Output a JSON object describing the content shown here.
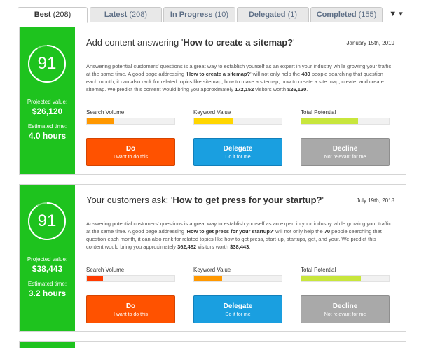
{
  "tabs": [
    {
      "label": "Best",
      "count": "(208)"
    },
    {
      "label": "Latest",
      "count": "(208)"
    },
    {
      "label": "In Progress",
      "count": "(10)"
    },
    {
      "label": "Delegated",
      "count": "(1)"
    },
    {
      "label": "Completed",
      "count": "(155)"
    }
  ],
  "filter_icon": "▼ ▾",
  "colors": {
    "sidebar": "#1ec31e",
    "do": "#ff5200",
    "delegate": "#1a9fe0",
    "decline": "#a9a9a9",
    "orange": "#ff9800",
    "red": "#ff3b00",
    "yellow": "#ffd600",
    "lime": "#c8e63c"
  },
  "labels": {
    "projected": "Projected value:",
    "estimated": "Estimated time:",
    "search_volume": "Search Volume",
    "keyword_value": "Keyword Value",
    "total_potential": "Total Potential",
    "do_title": "Do",
    "do_sub": "I want to do this",
    "delegate_title": "Delegate",
    "delegate_sub": "Do it for me",
    "decline_title": "Decline",
    "decline_sub": "Not relevant for me"
  },
  "cards": [
    {
      "score": "91",
      "score_fraction": 0.91,
      "projected_value": "$26,120",
      "estimated_time": "4.0 hours",
      "title_prefix": "Add content answering '",
      "title_bold": "How to create a sitemap?",
      "title_suffix": "'",
      "date": "January 15th, 2019",
      "desc_1": "Answering potential customers' questions is a great way to establish yourself as an expert in your industry while growing your traffic at the same time. A good page addressing '",
      "desc_b1": "How to create a sitemap?",
      "desc_2": "' will not only help the ",
      "desc_b2": "480",
      "desc_3": " people searching that question each month, it can also rank for related topics like sitemap, how to make a sitemap, how to create a site map, create, and create sitemap. We predict this content would bring you approximately ",
      "desc_b3": "172,152",
      "desc_4": " visitors worth ",
      "desc_b4": "$26,120",
      "desc_5": ".",
      "search_volume": 0.3,
      "keyword_value": 0.45,
      "total_potential": 0.65
    },
    {
      "score": "91",
      "score_fraction": 0.91,
      "projected_value": "$38,443",
      "estimated_time": "3.2 hours",
      "title_prefix": "Your customers ask: '",
      "title_bold": "How to get press for your startup?",
      "title_suffix": "'",
      "date": "July 19th, 2018",
      "desc_1": "Answering potential customers' questions is a great way to establish yourself as an expert in your industry while growing your traffic at the same time. A good page addressing '",
      "desc_b1": "How to get press for your startup?",
      "desc_2": "' will not only help the ",
      "desc_b2": "70",
      "desc_3": " people searching that question each month, it can also rank for related topics like how to get press, start-up, startups, get, and your. We predict this content would bring you approximately ",
      "desc_b3": "362,482",
      "desc_4": " visitors worth ",
      "desc_b4": "$38,443",
      "desc_5": ".",
      "search_volume": 0.18,
      "keyword_value": 0.32,
      "total_potential": 0.68
    }
  ]
}
